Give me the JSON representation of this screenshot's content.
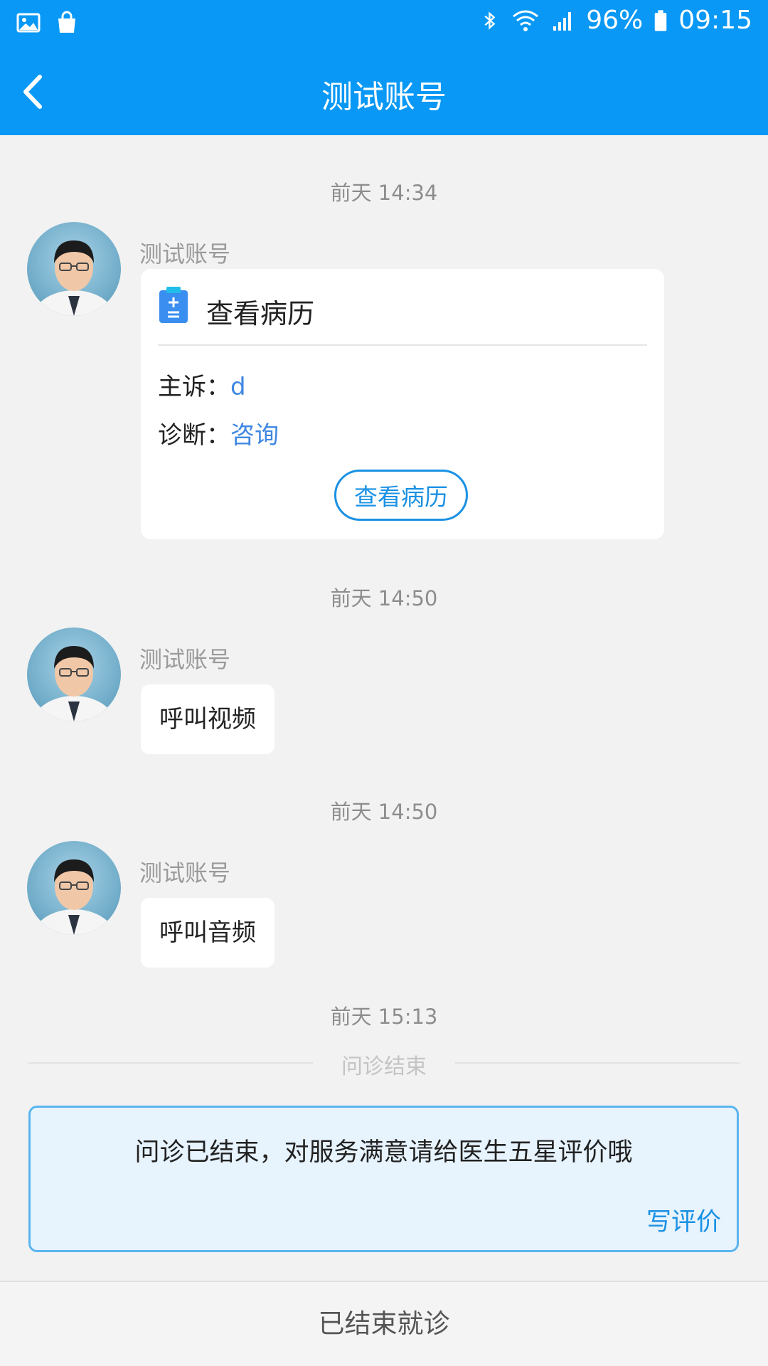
{
  "status_bar": {
    "battery": "96%",
    "time": "09:15",
    "icons": [
      "gallery-icon",
      "shopping-bag-icon",
      "bluetooth-icon",
      "wifi-icon",
      "signal-icon",
      "battery-icon"
    ]
  },
  "nav": {
    "back_icon": "chevron-left-icon",
    "title": "测试账号"
  },
  "messages": [
    {
      "timestamp": "前天 14:34",
      "sender": "测试账号",
      "type": "record_card",
      "card": {
        "icon": "clipboard-icon",
        "title": "查看病历",
        "complaint_label": "主诉：",
        "complaint_value": "d",
        "diagnosis_label": "诊断：",
        "diagnosis_value": "咨询",
        "button_label": "查看病历"
      }
    },
    {
      "timestamp": "前天 14:50",
      "sender": "测试账号",
      "type": "text",
      "text": "呼叫视频"
    },
    {
      "timestamp": "前天 14:50",
      "sender": "测试账号",
      "type": "text",
      "text": "呼叫音频"
    }
  ],
  "end_section": {
    "timestamp": "前天 15:13",
    "divider_label": "问诊结束",
    "review_text": "问诊已结束，对服务满意请给医生五星评价哦",
    "review_link": "写评价"
  },
  "bottom_bar": {
    "label": "已结束就诊"
  },
  "colors": {
    "brand_blue": "#0998f5",
    "link_blue": "#1a91e4",
    "value_blue": "#3f86e0",
    "background": "#f2f2f2"
  }
}
